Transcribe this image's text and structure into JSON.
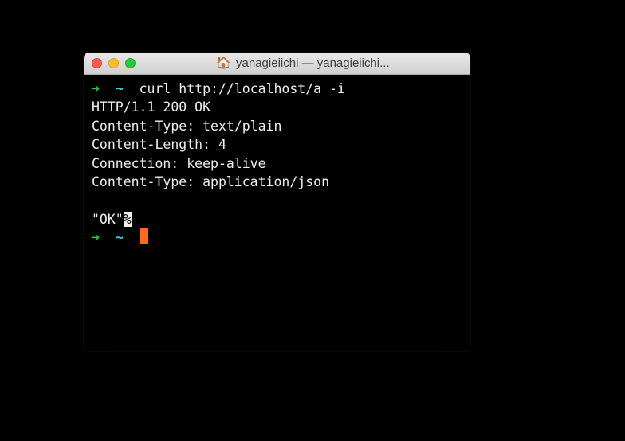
{
  "window": {
    "title": "yanagieiichi — yanagieiichi..."
  },
  "prompt": {
    "arrow": "➜",
    "tilde": "~"
  },
  "command": "curl http://localhost/a -i",
  "output": {
    "status": "HTTP/1.1 200 OK",
    "header1": "Content-Type: text/plain",
    "header2": "Content-Length: 4",
    "header3": "Connection: keep-alive",
    "header4": "Content-Type: application/json",
    "body": "\"OK\"",
    "trailing": "%"
  }
}
